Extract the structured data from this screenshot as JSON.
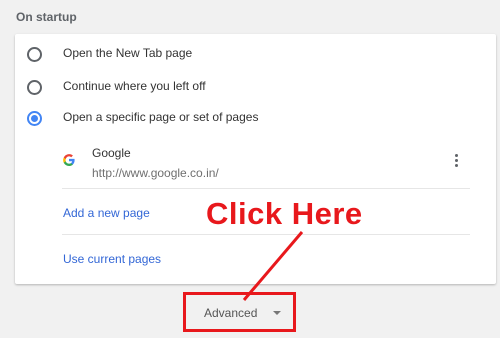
{
  "section": {
    "title": "On startup"
  },
  "startup_options": [
    {
      "label": "Open the New Tab page",
      "selected": false
    },
    {
      "label": "Continue where you left off",
      "selected": false
    },
    {
      "label": "Open a specific page or set of pages",
      "selected": true
    }
  ],
  "pages": [
    {
      "name": "Google",
      "url": "http://www.google.co.in/",
      "icon": "google-g-icon"
    }
  ],
  "actions": {
    "add_page": "Add a new page",
    "use_current": "Use current pages"
  },
  "advanced": {
    "label": "Advanced",
    "icon": "caret-down-icon"
  },
  "annotation": {
    "text": "Click Here",
    "color": "#e8181c"
  },
  "colors": {
    "accent": "#4285f4",
    "link": "#3367d6",
    "annotation": "#e8181c"
  }
}
